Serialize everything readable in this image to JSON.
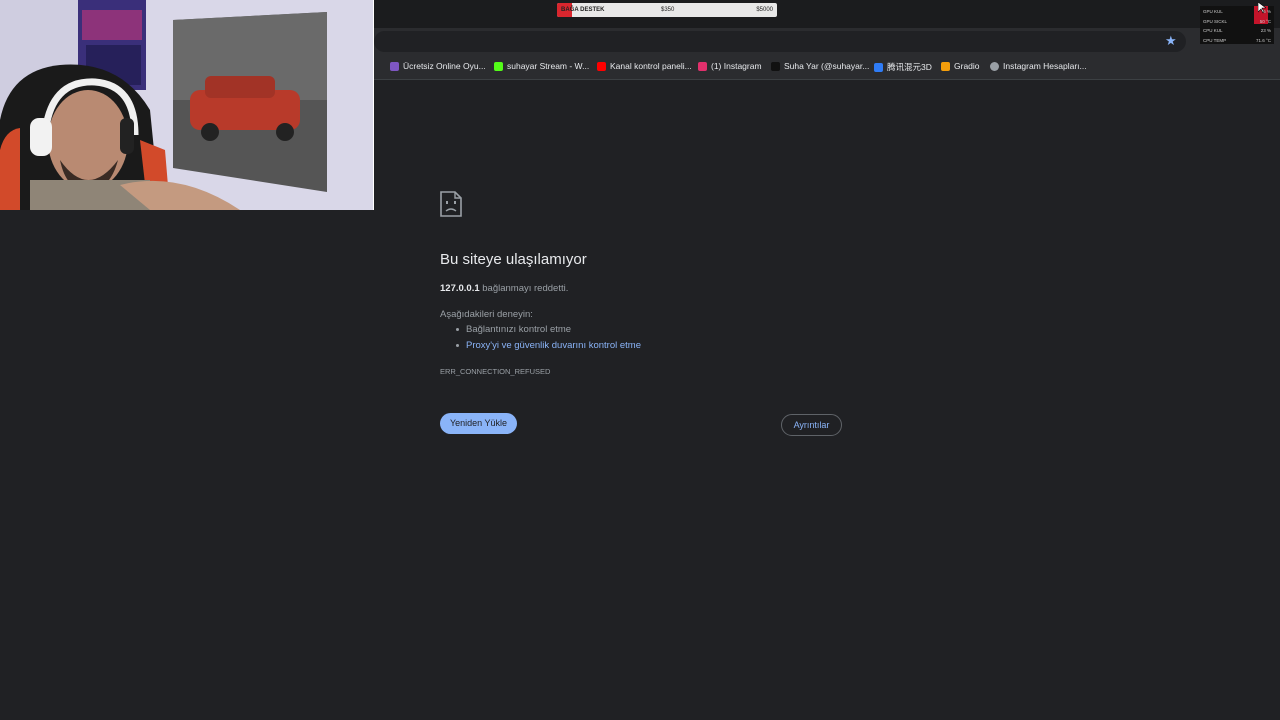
{
  "overlay": {
    "donation": {
      "label": "BAĞA DESTEK",
      "current": "$350",
      "goal": "$5000",
      "progress": 0.07
    },
    "stats": [
      {
        "label": "GPU KUL",
        "value": "5 %"
      },
      {
        "label": "GPU SICKL",
        "value": "50 °C"
      },
      {
        "label": "CPU KUL",
        "value": "23 %"
      },
      {
        "label": "CPU TEMP",
        "value": "71.6 °C"
      }
    ]
  },
  "bookmarks": [
    {
      "label": "Ücretsiz Online Oyu...",
      "icon": "purple-game-icon",
      "color": "#7e57c2"
    },
    {
      "label": "suhayar Stream - W...",
      "icon": "kick-icon",
      "color": "#53fc18"
    },
    {
      "label": "Kanal kontrol paneli...",
      "icon": "youtube-icon",
      "color": "#ff0000"
    },
    {
      "label": "(1) Instagram",
      "icon": "instagram-icon",
      "color": "#e1306c"
    },
    {
      "label": "Suha Yar (@suhayar...",
      "icon": "tiktok-icon",
      "color": "#111111"
    },
    {
      "label": "腾讯混元3D",
      "icon": "hunyuan-icon",
      "color": "#2f7cf6"
    },
    {
      "label": "Gradio",
      "icon": "gradio-icon",
      "color": "#f59e0b"
    },
    {
      "label": "Instagram Hesapları...",
      "icon": "globe-icon",
      "color": "#9aa0a6"
    }
  ],
  "error": {
    "title": "Bu siteye ulaşılamıyor",
    "host": "127.0.0.1",
    "message": "bağlanmayı reddetti.",
    "try_label": "Aşağıdakileri deneyin:",
    "suggestions": [
      {
        "text": "Bağlantınızı kontrol etme",
        "link": false
      },
      {
        "text": "Proxy'yi ve güvenlik duvarını kontrol etme",
        "link": true
      }
    ],
    "code": "ERR_CONNECTION_REFUSED",
    "reload_label": "Yeniden Yükle",
    "details_label": "Ayrıntılar"
  },
  "colors": {
    "background": "#202124",
    "link": "#8ab4f8",
    "accent": "#8ab4f8"
  }
}
